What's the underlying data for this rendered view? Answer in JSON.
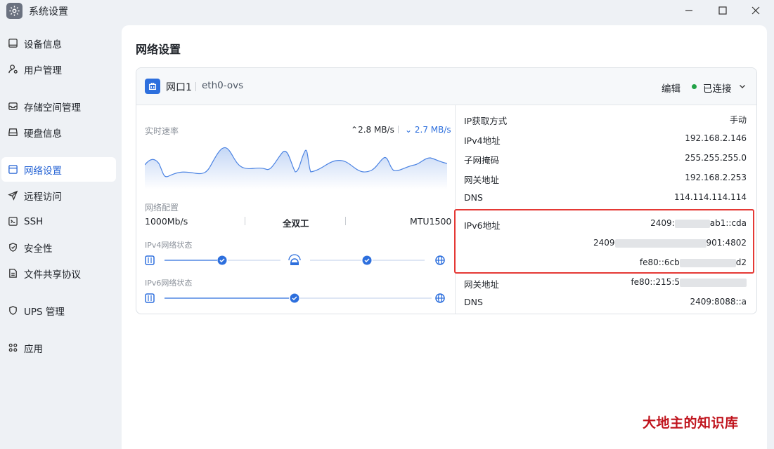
{
  "window": {
    "title": "系统设置"
  },
  "sidebar": {
    "items": [
      {
        "label": "设备信息",
        "icon": "device-info-icon"
      },
      {
        "label": "用户管理",
        "icon": "user-icon"
      },
      {
        "label": "存储空间管理",
        "icon": "storage-icon"
      },
      {
        "label": "硬盘信息",
        "icon": "disk-icon"
      },
      {
        "label": "网络设置",
        "icon": "network-icon",
        "active": true
      },
      {
        "label": "远程访问",
        "icon": "send-icon"
      },
      {
        "label": "SSH",
        "icon": "terminal-icon"
      },
      {
        "label": "安全性",
        "icon": "shield-icon"
      },
      {
        "label": "文件共享协议",
        "icon": "document-icon"
      },
      {
        "label": "UPS 管理",
        "icon": "ups-shield-icon"
      },
      {
        "label": "应用",
        "icon": "apps-icon"
      }
    ]
  },
  "main": {
    "title": "网络设置",
    "port": {
      "name": "网口1",
      "interface": "eth0-ovs",
      "edit_label": "编辑",
      "status": "已连接",
      "status_color": "#22a247"
    },
    "left": {
      "speed_label": "实时速率",
      "upload": "2.8 MB/s",
      "download": "2.7 MB/s",
      "config_label": "网络配置",
      "speed": "1000Mb/s",
      "duplex": "全双工",
      "mtu": "MTU1500",
      "ipv4_status_label": "IPv4网络状态",
      "ipv6_status_label": "IPv6网络状态"
    },
    "right": {
      "rows": [
        {
          "label": "IP获取方式",
          "value": "手动"
        },
        {
          "label": "IPv4地址",
          "value": "192.168.2.146"
        },
        {
          "label": "子网掩码",
          "value": "255.255.255.0"
        },
        {
          "label": "网关地址",
          "value": "192.168.2.253"
        },
        {
          "label": "DNS",
          "value": "114.114.114.114"
        }
      ],
      "ipv6_label": "IPv6地址",
      "ipv6_addr1_start": "2409:",
      "ipv6_addr1_end": "ab1::cda",
      "ipv6_addr2_start": "2409",
      "ipv6_addr2_end": "901:4802",
      "ipv6_addr3_start": "fe80::6cb",
      "ipv6_addr3_end": "d2",
      "gw6_label": "网关地址",
      "gw6_value_start": "fe80::215:5",
      "dns6_label": "DNS",
      "dns6_value": "2409:8088::a"
    },
    "accent_color": "#2d6fdd"
  },
  "watermark": "大地主的知识库"
}
